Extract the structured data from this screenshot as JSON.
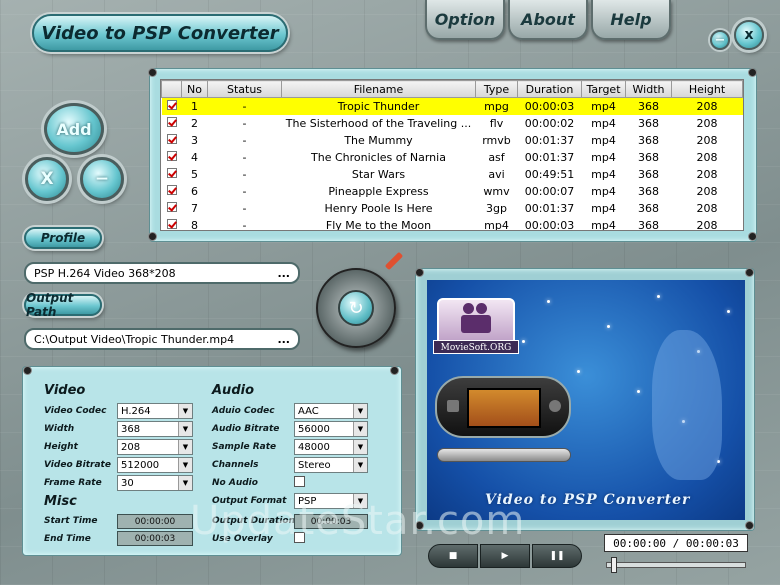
{
  "app": {
    "title": "Video to PSP Converter"
  },
  "top_menu": {
    "option": "Option",
    "about": "About",
    "help": "Help"
  },
  "window_controls": {
    "minimize": "−",
    "close": "x"
  },
  "side_buttons": {
    "add": "Add",
    "remove": "X",
    "minus": "−"
  },
  "table": {
    "headers": [
      "No",
      "Status",
      "Filename",
      "Type",
      "Duration",
      "Target",
      "Width",
      "Height"
    ],
    "rows": [
      [
        "1",
        "-",
        "Tropic Thunder",
        "mpg",
        "00:00:03",
        "mp4",
        "368",
        "208"
      ],
      [
        "2",
        "-",
        "The Sisterhood of the Traveling ...",
        "flv",
        "00:00:02",
        "mp4",
        "368",
        "208"
      ],
      [
        "3",
        "-",
        "The Mummy",
        "rmvb",
        "00:01:37",
        "mp4",
        "368",
        "208"
      ],
      [
        "4",
        "-",
        "The Chronicles of Narnia",
        "asf",
        "00:01:37",
        "mp4",
        "368",
        "208"
      ],
      [
        "5",
        "-",
        "Star Wars",
        "avi",
        "00:49:51",
        "mp4",
        "368",
        "208"
      ],
      [
        "6",
        "-",
        "Pineapple Express",
        "wmv",
        "00:00:07",
        "mp4",
        "368",
        "208"
      ],
      [
        "7",
        "-",
        "Henry Poole Is Here",
        "3gp",
        "00:01:37",
        "mp4",
        "368",
        "208"
      ],
      [
        "8",
        "-",
        "Fly Me to the Moon",
        "mp4",
        "00:00:03",
        "mp4",
        "368",
        "208"
      ]
    ]
  },
  "profile": {
    "button": "Profile",
    "value": "PSP H.264 Video 368*208",
    "browse": "..."
  },
  "output": {
    "button": "Output Path",
    "value": "C:\\Output Video\\Tropic Thunder.mp4",
    "browse": "..."
  },
  "video": {
    "title": "Video",
    "codec_label": "Video Codec",
    "codec": "H.264",
    "width_label": "Width",
    "width": "368",
    "height_label": "Height",
    "height": "208",
    "bitrate_label": "Video Bitrate",
    "bitrate": "512000",
    "framerate_label": "Frame Rate",
    "framerate": "30"
  },
  "audio": {
    "title": "Audio",
    "codec_label": "Aduio Codec",
    "codec": "AAC",
    "bitrate_label": "Audio Bitrate",
    "bitrate": "56000",
    "samplerate_label": "Sample Rate",
    "samplerate": "48000",
    "channels_label": "Channels",
    "channels": "Stereo",
    "noaudio_label": "No Audio"
  },
  "misc": {
    "title": "Misc",
    "start_label": "Start Time",
    "start": "00:00:00",
    "end_label": "End Time",
    "end": "00:00:03",
    "format_label": "Output Format",
    "format": "PSP",
    "duration_label": "Output Duration",
    "duration": "00:00:03",
    "overlay_label": "Use Overlay"
  },
  "preview": {
    "logo_text": "MovieSoft.ORG",
    "caption": "Video to PSP Converter"
  },
  "player": {
    "time": "00:00:00 / 00:00:03"
  },
  "watermark": "UpdateStar.com",
  "colors": {
    "accent": "#6cc7d0",
    "selected_row": "#ffff00",
    "preview_bg": "#1550a8"
  }
}
